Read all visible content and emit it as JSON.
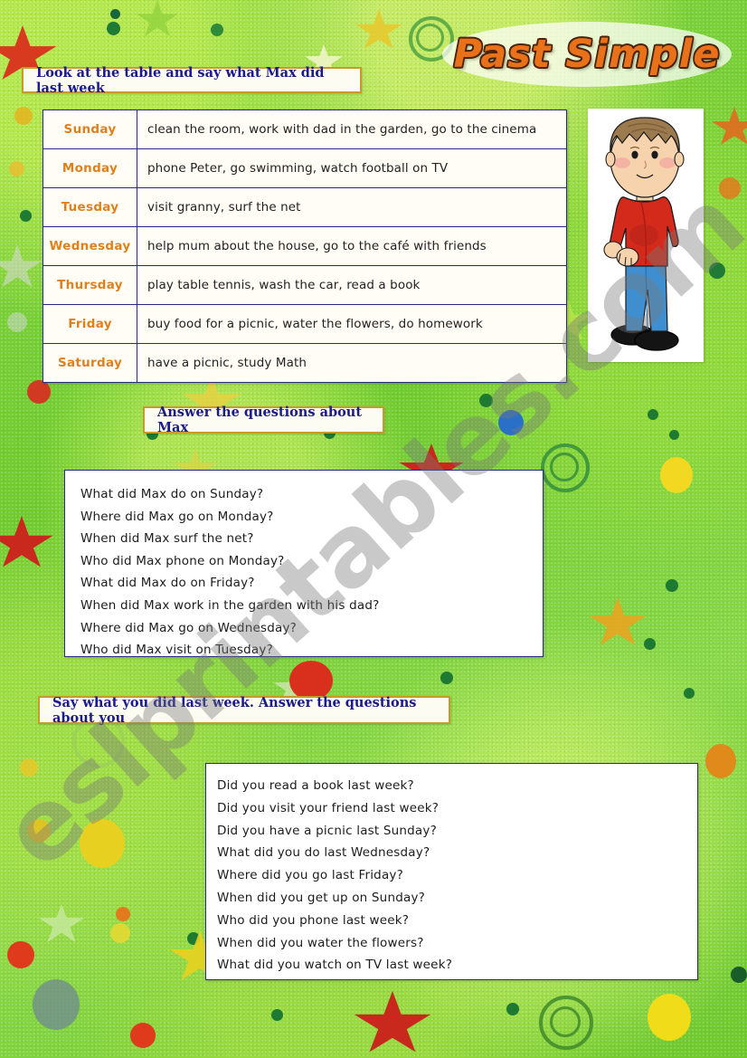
{
  "title": "Past Simple",
  "watermark": "eslprintables.com",
  "instructions": {
    "first": "Look at the table and say what Max did last week",
    "second": "Answer the questions about Max",
    "third": "Say what you did last week. Answer the questions about you"
  },
  "schedule": {
    "rows": [
      {
        "day": "Sunday",
        "activities": "clean the room, work with dad in the garden, go to the cinema"
      },
      {
        "day": "Monday",
        "activities": "phone Peter, go swimming, watch football on TV"
      },
      {
        "day": "Tuesday",
        "activities": "visit granny, surf the net"
      },
      {
        "day": "Wednesday",
        "activities": "help mum about the house, go to the café with friends"
      },
      {
        "day": "Thursday",
        "activities": "play table tennis, wash the car, read a book"
      },
      {
        "day": "Friday",
        "activities": "buy food for a picnic, water the flowers, do homework"
      },
      {
        "day": "Saturday",
        "activities": "have a picnic, study Math"
      }
    ]
  },
  "questions_about_max": [
    "What did Max do on Sunday?",
    "Where did Max go on Monday?",
    "When did Max surf the net?",
    "Who did Max phone on Monday?",
    "What did Max do on Friday?",
    "When did Max work in the garden with his dad?",
    "Where did Max go on Wednesday?",
    "Who did Max visit on Tuesday?"
  ],
  "questions_about_you": [
    "Did you read a book last week?",
    "Did you visit your friend last week?",
    "Did you have a picnic last Sunday?",
    "What did you do last Wednesday?",
    "Where did you go last Friday?",
    "When did you get up on Sunday?",
    "Who did you phone last week?",
    "When did you water the flowers?",
    "What did you watch on TV last week?"
  ],
  "illustration": {
    "name": "cartoon-boy",
    "hair_color": "#9c7a4f",
    "skin_color": "#f6d3ad",
    "shirt_color": "#d32a1c",
    "trousers_color": "#3f8fd0",
    "shoes_color": "#1a1a1a"
  },
  "colors": {
    "background_green": "#7cd13a",
    "title_orange": "#e8711a",
    "instruction_blue": "#1a1a8c",
    "day_orange": "#e0801c",
    "border_navy": "#2a2a86",
    "banner_border_gold": "#c79a2e"
  }
}
